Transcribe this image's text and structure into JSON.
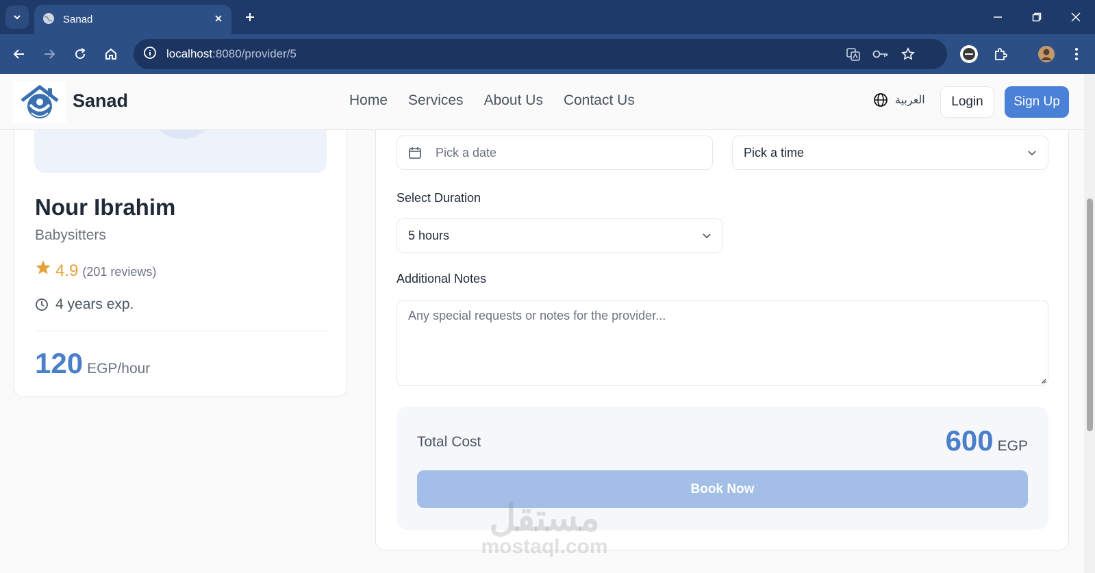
{
  "browser": {
    "tab_title": "Sanad",
    "url_host": "localhost",
    "url_rest": ":8080/provider/5"
  },
  "header": {
    "brand": "Sanad",
    "nav": [
      "Home",
      "Services",
      "About Us",
      "Contact Us"
    ],
    "language_label": "العربية",
    "login_label": "Login",
    "signup_label": "Sign Up"
  },
  "provider": {
    "name": "Nour Ibrahim",
    "category": "Babysitters",
    "rating": "4.9",
    "reviews": "(201 reviews)",
    "experience": "4 years exp.",
    "price": "120",
    "price_unit": "EGP/hour"
  },
  "booking": {
    "date_placeholder": "Pick a date",
    "time_value": "Pick a time",
    "duration_label": "Select Duration",
    "duration_value": "5 hours",
    "notes_label": "Additional Notes",
    "notes_placeholder": "Any special requests or notes for the provider...",
    "total_label": "Total Cost",
    "total_amount": "600",
    "total_currency": "EGP",
    "book_label": "Book Now"
  },
  "watermark": {
    "arabic": "مستقل",
    "latin": "mostaql.com"
  },
  "colors": {
    "accent": "#4a80d6",
    "price": "#4a7fc9",
    "star": "#e6a23c",
    "browser_frame": "#1e3a68"
  }
}
